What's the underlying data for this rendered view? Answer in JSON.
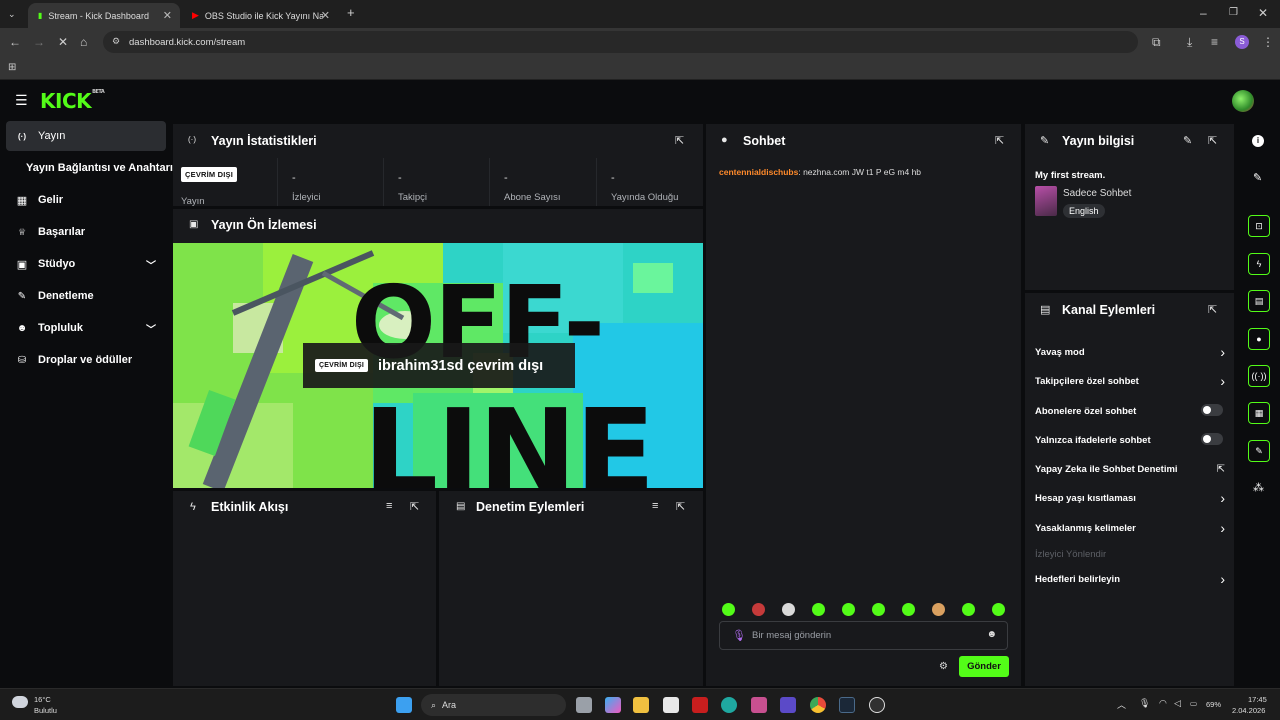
{
  "browser": {
    "tabs": [
      {
        "label": "Stream - Kick Dashboard",
        "active": true
      },
      {
        "label": "OBS Studio ile Kick Yayını Nasıl",
        "active": false
      }
    ],
    "new_tab": "+",
    "url": "dashboard.kick.com/stream",
    "profile_initial": "S"
  },
  "app": {
    "logo": "KICK",
    "logo_tag": "BETA",
    "sidebar": [
      {
        "label": "Yayın",
        "icon": "broadcast-icon",
        "glyph": "(·)",
        "active": true
      },
      {
        "label": "Yayın Bağlantısı ve Anahtarı",
        "icon": "",
        "glyph": ""
      },
      {
        "label": "Gelir",
        "icon": "chart-icon",
        "glyph": "▦"
      },
      {
        "label": "Başarılar",
        "icon": "trophy-icon",
        "glyph": "🏆"
      },
      {
        "label": "Stüdyo",
        "icon": "studio-icon",
        "glyph": "▣",
        "chevron": "⌄"
      },
      {
        "label": "Denetleme",
        "icon": "wrench-icon",
        "glyph": "🔧"
      },
      {
        "label": "Topluluk",
        "icon": "community-icon",
        "glyph": "👥",
        "chevron": "⌄"
      },
      {
        "label": "Droplar ve ödüller",
        "icon": "gift-icon",
        "glyph": "⛁"
      }
    ],
    "stats": {
      "title": "Yayın İstatistikleri",
      "badge": "ÇEVRİM DIŞI",
      "cells": [
        {
          "value": "",
          "label": "Yayın"
        },
        {
          "value": "-",
          "label": "İzleyici"
        },
        {
          "value": "-",
          "label": "Takipçi"
        },
        {
          "value": "-",
          "label": "Abone Sayısı"
        },
        {
          "value": "-",
          "label": "Yayında Olduğu"
        }
      ]
    },
    "preview": {
      "title": "Yayın Ön İzlemesi",
      "badge": "ÇEVRİM DIŞI",
      "message": "ibrahim31sd çevrim dışı",
      "bg_text_1": "OFF-",
      "bg_text_2": "LINE"
    },
    "activity": {
      "title": "Etkinlik Akışı"
    },
    "moderation": {
      "title": "Denetim Eylemleri"
    },
    "chat": {
      "title": "Sohbet",
      "messages": [
        {
          "user": "centennialdischubs",
          "text": ": nezhna.com JW t1 P eG m4 hb"
        }
      ],
      "placeholder": "Bir mesaj gönderin",
      "send": "Gönder"
    },
    "stream_info": {
      "title": "Yayın bilgisi",
      "stream_title": "My first stream.",
      "category": "Sadece Sohbet",
      "language": "English"
    },
    "channel_actions": {
      "title": "Kanal Eylemleri",
      "rows": [
        {
          "label": "Yavaş mod",
          "control": "chevron"
        },
        {
          "label": "Takipçilere özel sohbet",
          "control": "chevron"
        },
        {
          "label": "Abonelere özel sohbet",
          "control": "toggle",
          "on": false
        },
        {
          "label": "Yalnızca ifadelerle sohbet",
          "control": "toggle",
          "on": false
        },
        {
          "label": "Yapay Zeka ile Sohbet Denetimi",
          "control": "external"
        },
        {
          "label": "Hesap yaşı kısıtlaması",
          "control": "chevron"
        },
        {
          "label": "Yasaklanmış kelimeler",
          "control": "chevron"
        },
        {
          "label": "İzleyici Yönlendir",
          "control": "none",
          "disabled": true
        },
        {
          "label": "Hedefleri belirleyin",
          "control": "chevron"
        }
      ]
    }
  },
  "taskbar": {
    "weather_temp": "16°C",
    "weather_desc": "Bulutlu",
    "search": "Ara",
    "battery": "69%",
    "time": "17:45",
    "date": "2.04.2026"
  },
  "colors": {
    "accent": "#53fc18",
    "panel": "#18191c",
    "background": "#0b0c0e",
    "chat_user": "#ff8a2b"
  }
}
